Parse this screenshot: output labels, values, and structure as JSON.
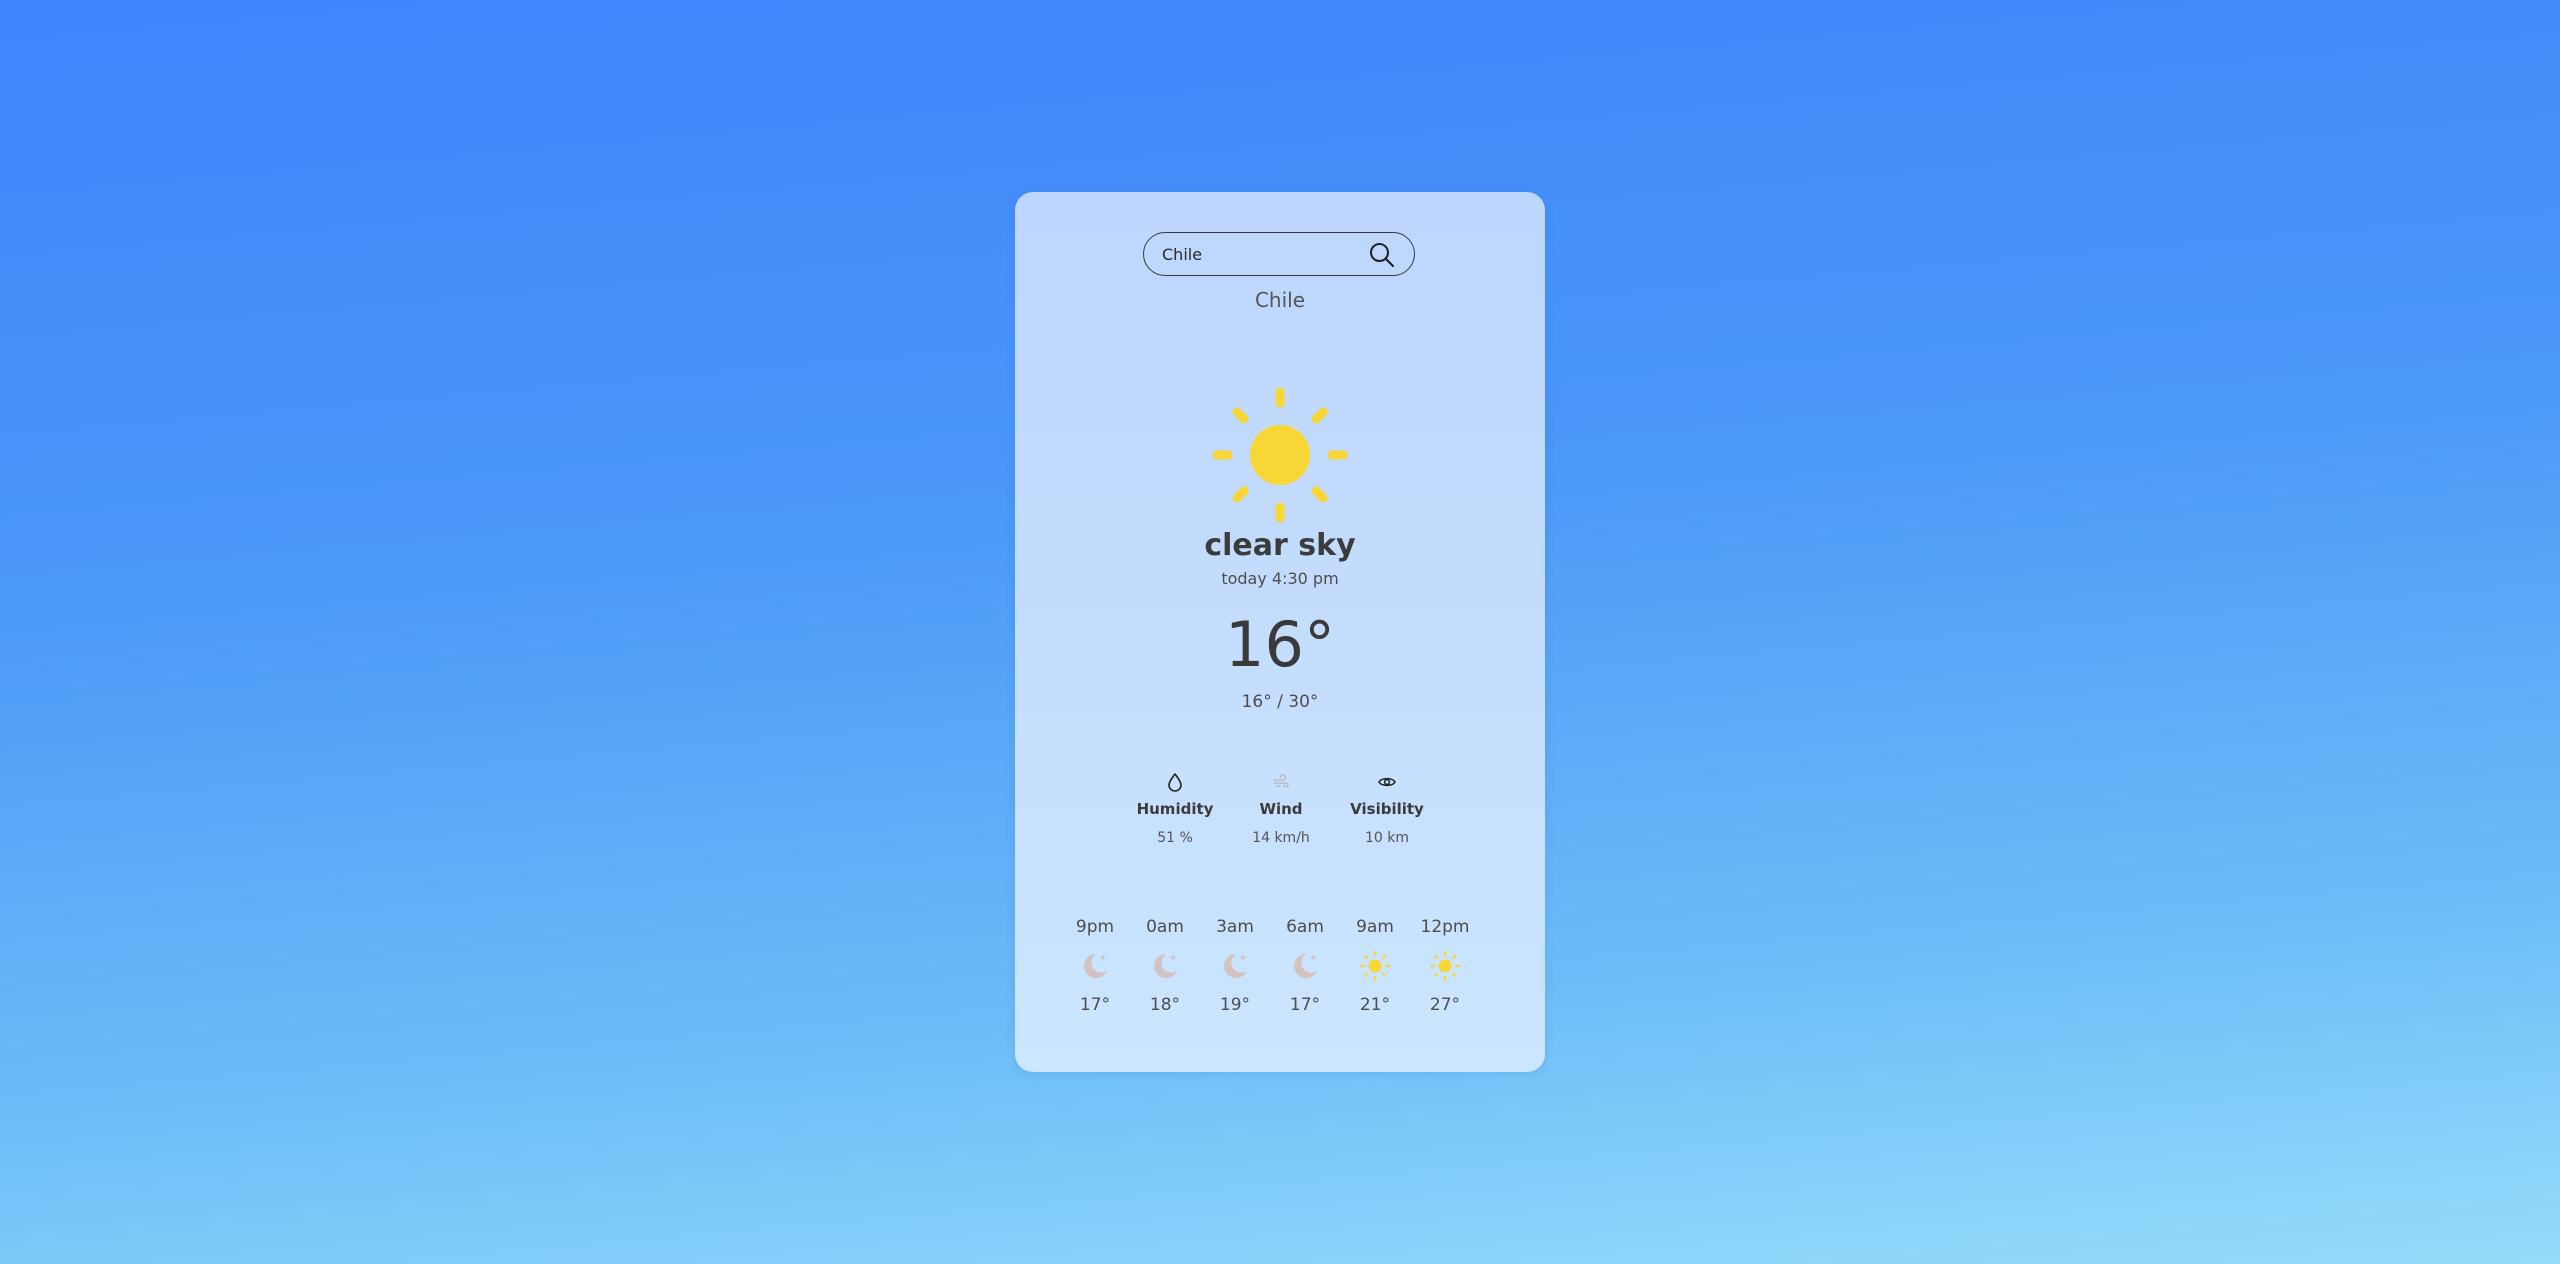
{
  "search": {
    "value": "Chile",
    "icon": "search-icon"
  },
  "current": {
    "city": "Chile",
    "condition_icon": "sun-icon",
    "description": "clear sky",
    "time": "today 4:30 pm",
    "temperature": "16°",
    "min_max": "16° / 30°"
  },
  "stats": [
    {
      "icon": "droplet-icon",
      "label": "Humidity",
      "value": "51 %"
    },
    {
      "icon": "wind-icon",
      "label": "Wind",
      "value": "14 km/h"
    },
    {
      "icon": "eye-icon",
      "label": "Visibility",
      "value": "10 km"
    }
  ],
  "hourly": [
    {
      "hour": "9pm",
      "icon": "moon-icon",
      "temp": "17°"
    },
    {
      "hour": "0am",
      "icon": "moon-icon",
      "temp": "18°"
    },
    {
      "hour": "3am",
      "icon": "moon-icon",
      "temp": "19°"
    },
    {
      "hour": "6am",
      "icon": "moon-icon",
      "temp": "17°"
    },
    {
      "hour": "9am",
      "icon": "sun-icon",
      "temp": "21°"
    },
    {
      "hour": "12pm",
      "icon": "sun-icon",
      "temp": "27°"
    }
  ],
  "colors": {
    "sun": "#f8d636",
    "moon": "#d4c2c0",
    "background_top": "#3f84fc",
    "background_bottom": "#95dcfb"
  }
}
